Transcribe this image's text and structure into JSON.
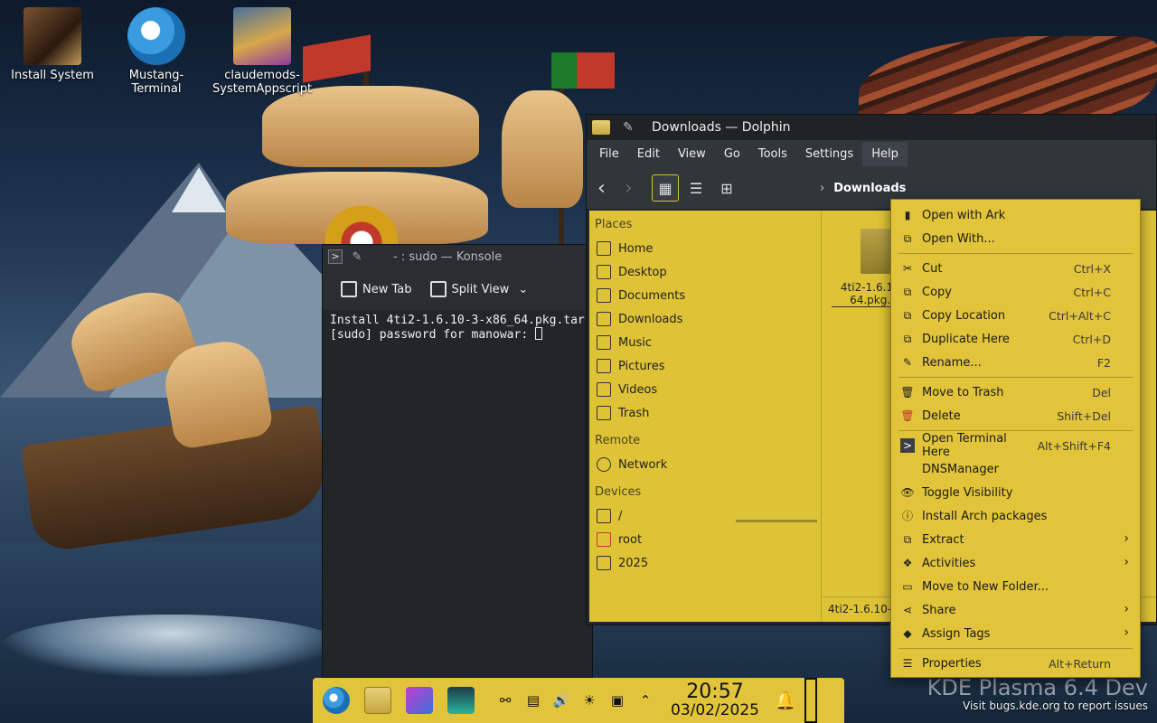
{
  "desktop": {
    "icons": [
      {
        "label": "Install System"
      },
      {
        "label": "Mustang-\nTerminal"
      },
      {
        "label": "claudemods-\nSystemAppscript"
      }
    ],
    "watermark": {
      "line1": "KDE Plasma 6.4 Dev",
      "line2": "Visit bugs.kde.org to report issues"
    }
  },
  "konsole": {
    "title": "- : sudo — Konsole",
    "toolbar": {
      "new_tab": "New Tab",
      "split_view": "Split View"
    },
    "lines": [
      "Install 4ti2-1.6.10-3-x86_64.pkg.tar",
      "[sudo] password for manowar: "
    ]
  },
  "dolphin": {
    "title": "Downloads — Dolphin",
    "menu": [
      "File",
      "Edit",
      "View",
      "Go",
      "Tools",
      "Settings",
      "Help"
    ],
    "breadcrumb": "Downloads",
    "places_heading": "Places",
    "places": [
      "Home",
      "Desktop",
      "Documents",
      "Downloads",
      "Music",
      "Pictures",
      "Videos",
      "Trash"
    ],
    "remote_heading": "Remote",
    "remote": [
      "Network"
    ],
    "devices_heading": "Devices",
    "devices": [
      "/",
      "root",
      "2025"
    ],
    "file": {
      "name": "4ti2-1.6.10-\n64.pkg.t"
    },
    "status": "4ti2-1.6.10-3"
  },
  "context_menu": {
    "items": [
      {
        "label": "Open with Ark",
        "shortcut": ""
      },
      {
        "label": "Open With...",
        "shortcut": ""
      },
      {
        "label": "Cut",
        "shortcut": "Ctrl+X"
      },
      {
        "label": "Copy",
        "shortcut": "Ctrl+C"
      },
      {
        "label": "Copy Location",
        "shortcut": "Ctrl+Alt+C"
      },
      {
        "label": "Duplicate Here",
        "shortcut": "Ctrl+D"
      },
      {
        "label": "Rename...",
        "shortcut": "F2"
      },
      {
        "label": "Move to Trash",
        "shortcut": "Del"
      },
      {
        "label": "Delete",
        "shortcut": "Shift+Del"
      },
      {
        "label": "Open Terminal Here",
        "shortcut": "Alt+Shift+F4"
      },
      {
        "label": "DNSManager",
        "shortcut": ""
      },
      {
        "label": "Toggle Visibility",
        "shortcut": ""
      },
      {
        "label": "Install Arch packages",
        "shortcut": ""
      },
      {
        "label": "Extract",
        "shortcut": ""
      },
      {
        "label": "Activities",
        "shortcut": ""
      },
      {
        "label": "Move to New Folder...",
        "shortcut": ""
      },
      {
        "label": "Share",
        "shortcut": ""
      },
      {
        "label": "Assign Tags",
        "shortcut": ""
      },
      {
        "label": "Properties",
        "shortcut": "Alt+Return"
      }
    ]
  },
  "taskbar": {
    "time": "20:57",
    "date": "03/02/2025"
  },
  "colors": {
    "accent": "#e2c43a",
    "dark_bg": "#232629"
  }
}
